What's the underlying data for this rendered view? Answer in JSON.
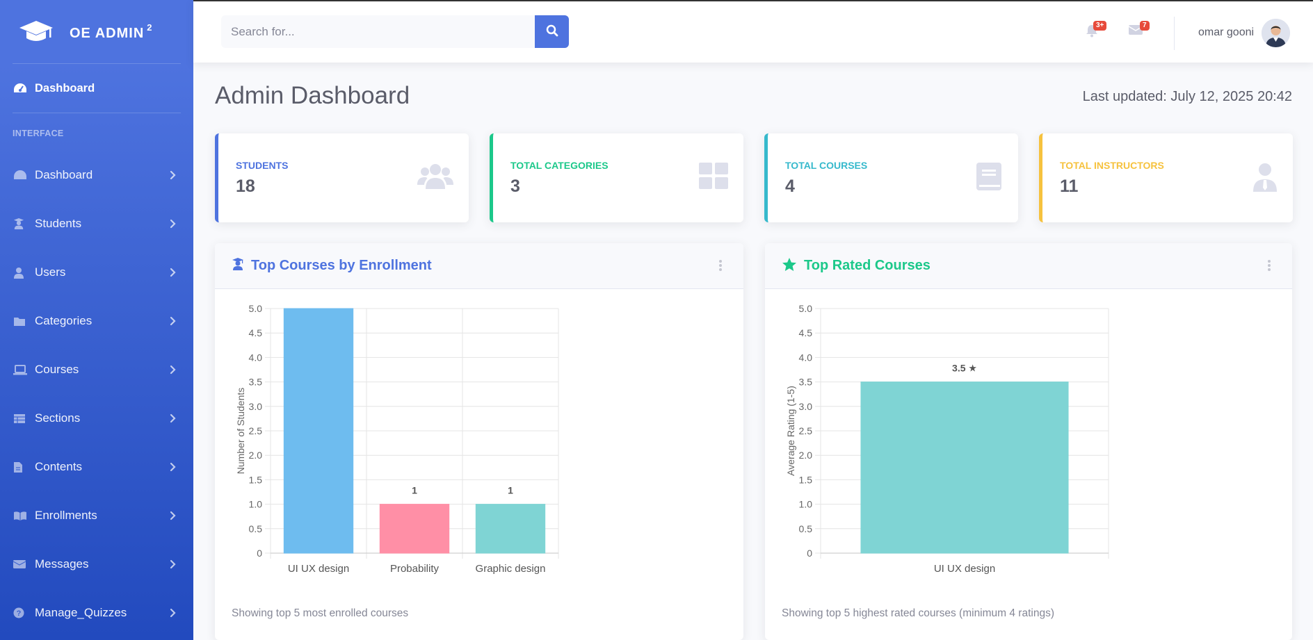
{
  "brand": {
    "name": "OE ADMIN",
    "superscript": "2"
  },
  "sidebar": {
    "active": {
      "label": "Dashboard",
      "icon": "tachometer-icon"
    },
    "heading": "INTERFACE",
    "items": [
      {
        "label": "Dashboard",
        "icon": "tachometer-icon"
      },
      {
        "label": "Students",
        "icon": "graduate-icon"
      },
      {
        "label": "Users",
        "icon": "user-icon"
      },
      {
        "label": "Categories",
        "icon": "folder-icon"
      },
      {
        "label": "Courses",
        "icon": "laptop-icon"
      },
      {
        "label": "Sections",
        "icon": "table-icon"
      },
      {
        "label": "Contents",
        "icon": "file-icon"
      },
      {
        "label": "Enrollments",
        "icon": "book-open-icon"
      },
      {
        "label": "Messages",
        "icon": "envelope-icon"
      },
      {
        "label": "Manage_Quizzes",
        "icon": "question-circle-icon"
      }
    ]
  },
  "topbar": {
    "search_placeholder": "Search for...",
    "alerts_badge": "3+",
    "messages_badge": "7",
    "user_name": "omar gooni"
  },
  "page": {
    "title": "Admin Dashboard",
    "last_updated": "Last updated: July 12, 2025 20:42"
  },
  "stats": [
    {
      "label": "STUDENTS",
      "value": "18",
      "color": "#4e73df",
      "icon": "users-icon"
    },
    {
      "label": "TOTAL CATEGORIES",
      "value": "3",
      "color": "#1cc88a",
      "icon": "th-large-icon"
    },
    {
      "label": "TOTAL COURSES",
      "value": "4",
      "color": "#36b9cc",
      "icon": "book-icon"
    },
    {
      "label": "TOTAL INSTRUCTORS",
      "value": "11",
      "color": "#f6c23e",
      "icon": "user-tie-icon"
    }
  ],
  "panels": {
    "enrollment": {
      "title": "Top Courses by Enrollment",
      "footer": "Showing top 5 most enrolled courses",
      "color": "#4e73df"
    },
    "rated": {
      "title": "Top Rated Courses",
      "footer": "Showing top 5 highest rated courses (minimum 4 ratings)",
      "color": "#1cc88a"
    }
  },
  "chart_data": [
    {
      "type": "bar",
      "title": "",
      "categories": [
        "UI UX design",
        "Probability",
        "Graphic design"
      ],
      "values": [
        5,
        1,
        1
      ],
      "data_labels": [
        "",
        "1",
        "1"
      ],
      "colors": [
        "#6ebcef",
        "#ff8fa6",
        "#7fd4d4"
      ],
      "ylabel": "Number of Students",
      "xlabel": "",
      "ylim": [
        0,
        5
      ],
      "yticks": [
        "0",
        "0.5",
        "1.0",
        "1.5",
        "2.0",
        "2.5",
        "3.0",
        "3.5",
        "4.0",
        "4.5",
        "5.0"
      ],
      "grid": true
    },
    {
      "type": "bar",
      "title": "",
      "categories": [
        "UI UX design"
      ],
      "values": [
        3.5
      ],
      "data_labels": [
        "3.5 ★"
      ],
      "colors": [
        "#7fd4d4"
      ],
      "ylabel": "Average Rating (1-5)",
      "xlabel": "",
      "ylim": [
        0,
        5
      ],
      "yticks": [
        "0",
        "0.5",
        "1.0",
        "1.5",
        "2.0",
        "2.5",
        "3.0",
        "3.5",
        "4.0",
        "4.5",
        "5.0"
      ],
      "grid": true
    }
  ]
}
